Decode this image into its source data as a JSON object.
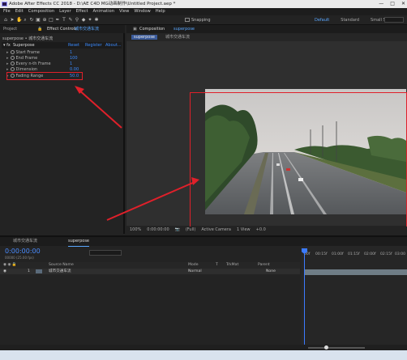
{
  "window": {
    "title": "Adobe After Effects CC 2018 - D:\\AE C4D MG动画制作\\Untitled Project.aep *",
    "controls": [
      "—",
      "□",
      "✕"
    ]
  },
  "menubar": [
    "File",
    "Edit",
    "Composition",
    "Layer",
    "Effect",
    "Animation",
    "View",
    "Window",
    "Help"
  ],
  "toolbar": {
    "snapping": "Snapping",
    "workspaces": [
      "Default",
      "Standard",
      "Small Screen"
    ]
  },
  "left_panel": {
    "tabs": [
      "Project",
      "Effect Controls",
      "城市交通车流"
    ],
    "header": "superpose • 城市交通车流",
    "effect": {
      "name": "Superpose",
      "actions": [
        "Reset",
        "Register",
        "About..."
      ]
    },
    "properties": [
      {
        "label": "Start Frame",
        "value": "1"
      },
      {
        "label": "End Frame",
        "value": "100"
      },
      {
        "label": "Every n-th Frame",
        "value": "1"
      },
      {
        "label": "Dimension",
        "value": "0.00"
      },
      {
        "label": "Fading Range",
        "value": "50.0"
      }
    ]
  },
  "viewer": {
    "tabs": [
      "Composition",
      "superpose"
    ],
    "subtab": "superpose",
    "breadcrumb": "城市交通车流",
    "bottom": [
      "100%",
      "0:00:00:00",
      "(Full)",
      "Active Camera",
      "1 View",
      "+0.0"
    ]
  },
  "timeline": {
    "tabs": [
      "城市交通车流",
      "superpose"
    ],
    "timecode": "0:00:00:00",
    "timecode_sub": "00000 (25.00 fps)",
    "columns": [
      "Source Name",
      "Mode",
      "T",
      "TrkMat",
      "Parent"
    ],
    "layer": {
      "index": "1",
      "name": "城市交通车流",
      "mode": "Normal",
      "parent": "None"
    },
    "ruler": [
      "00f",
      "00:15f",
      "01:00f",
      "01:15f",
      "02:00f",
      "02:15f",
      "03:00"
    ]
  },
  "colors": {
    "accent_blue": "#3b8bff",
    "highlight_red": "#e0202a"
  }
}
